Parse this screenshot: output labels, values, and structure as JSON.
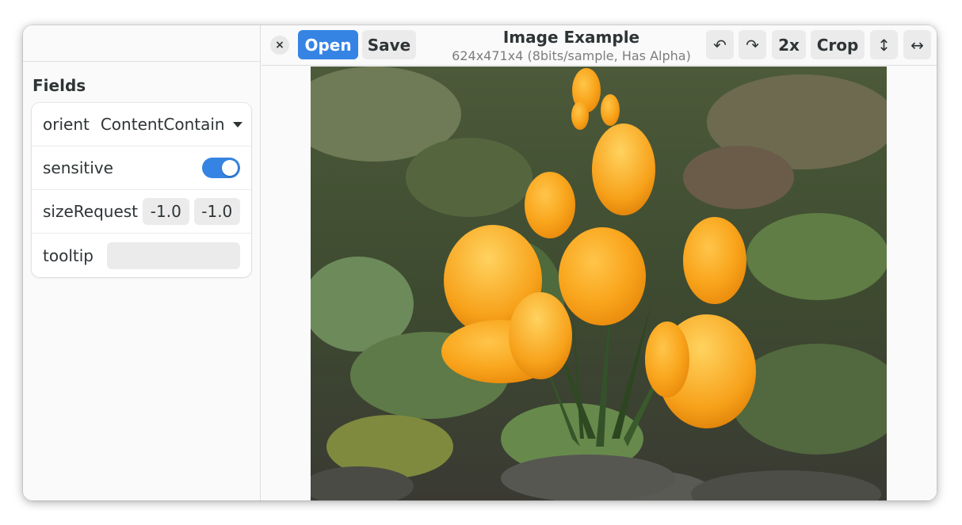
{
  "sidebar": {
    "title": "Fields",
    "fields": {
      "orient": {
        "label": "orient",
        "value": "ContentContain"
      },
      "sensitive": {
        "label": "sensitive",
        "checked": true
      },
      "sizeRequest": {
        "label": "sizeRequest",
        "width": "-1.0",
        "height": "-1.0"
      },
      "tooltip": {
        "label": "tooltip",
        "value": ""
      }
    }
  },
  "header": {
    "close_icon": "×",
    "open_label": "Open",
    "save_label": "Save",
    "title": "Image Example",
    "subtitle": "624x471x4 (8bits/sample, Has Alpha)",
    "rotate_left_icon": "↶",
    "rotate_right_icon": "↷",
    "zoom_label": "2x",
    "crop_label": "Crop",
    "flip_vertical_icon": "↕",
    "flip_horizontal_icon": "↔"
  },
  "colors": {
    "accent": "#3584e4",
    "window_bg": "#fafafa"
  },
  "image": {
    "subject": "orange crocus flowers"
  }
}
